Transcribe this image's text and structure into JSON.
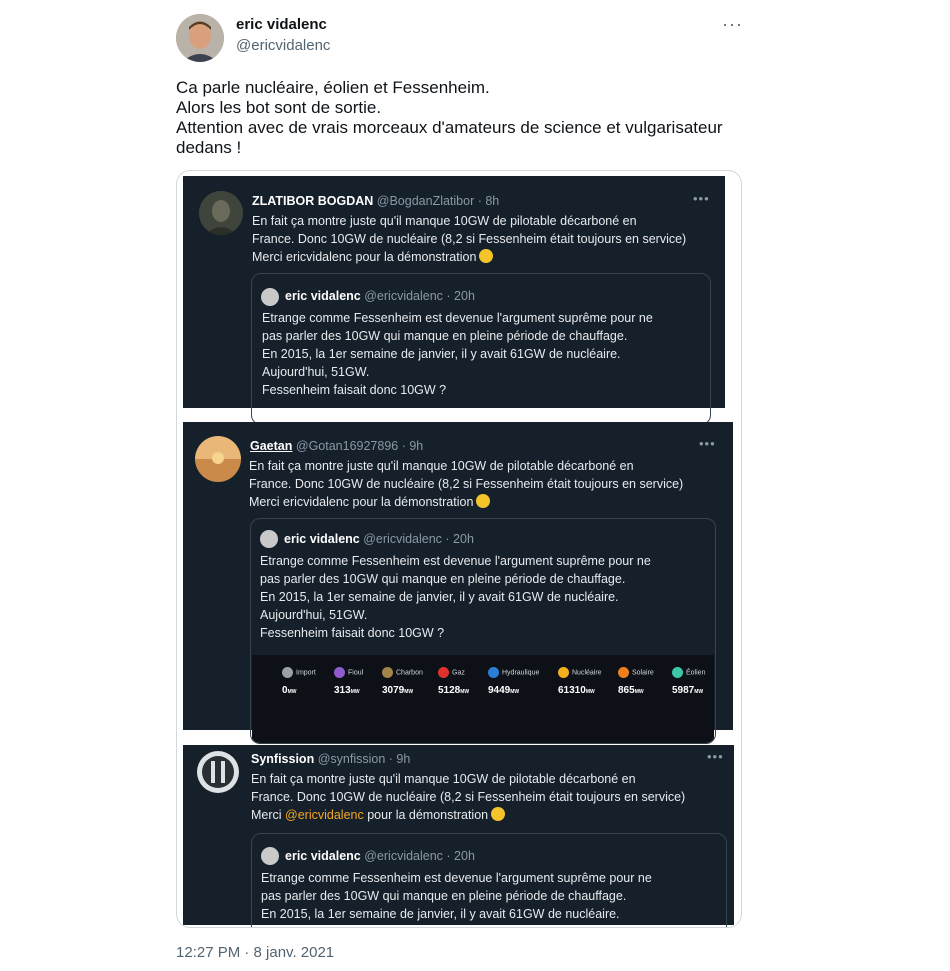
{
  "tweet": {
    "author_name": "eric vidalenc",
    "author_handle": "@ericvidalenc",
    "more_label": "···",
    "text_lines": [
      "Ca parle nucléaire, éolien et Fessenheim.",
      "Alors les bot sont de sortie.",
      "Attention avec de vrais morceaux d'amateurs de science et vulgarisateur",
      "dedans !"
    ],
    "timestamp": "12:27 PM · 8 janv. 2021"
  },
  "screenshots": [
    {
      "name": "ZLATIBOR BOGDAN",
      "handle": "@BogdanZlatibor · 8h",
      "lines": [
        "En fait ça montre juste qu'il manque 10GW de pilotable décarboné en",
        "France. Donc 10GW de nucléaire (8,2 si Fessenheim était toujours en service)"
      ],
      "last_prefix": "Merci  ericvidalenc pour la démonstration",
      "quote": {
        "name": "eric vidalenc",
        "handle": "@ericvidalenc · 20h",
        "lines": [
          "Etrange comme Fessenheim est devenue l'argument suprême pour ne",
          "pas parler des 10GW qui manque en pleine période de chauffage.",
          "En 2015, la 1er semaine de janvier, il y avait 61GW de nucléaire.",
          "Aujourd'hui, 51GW.",
          "Fessenheim faisait donc 10GW ?"
        ]
      }
    },
    {
      "name": "Gaetan",
      "handle": "@Gotan16927896 · 9h",
      "lines": [
        "En fait ça montre juste qu'il manque 10GW de pilotable décarboné en",
        "France. Donc 10GW de nucléaire (8,2 si Fessenheim était toujours en service)"
      ],
      "last_prefix": "Merci  ericvidalenc pour la démonstration",
      "quote": {
        "name": "eric vidalenc",
        "handle": "@ericvidalenc · 20h",
        "lines": [
          "Etrange comme Fessenheim est devenue l'argument suprême pour ne",
          "pas parler des 10GW qui manque en pleine période de chauffage.",
          "En 2015, la 1er semaine de janvier, il y avait 61GW de nucléaire.",
          "Aujourd'hui, 51GW.",
          "Fessenheim faisait donc 10GW ?"
        ]
      },
      "energy": [
        {
          "label": "Import",
          "value": "0",
          "unit": "MW",
          "color": "#9aa0a6"
        },
        {
          "label": "Fioul",
          "value": "313",
          "unit": "MW",
          "color": "#8e5ccf"
        },
        {
          "label": "Charbon",
          "value": "3079",
          "unit": "MW",
          "color": "#a3844a"
        },
        {
          "label": "Gaz",
          "value": "5128",
          "unit": "MW",
          "color": "#e0322c"
        },
        {
          "label": "Hydraulique",
          "value": "9449",
          "unit": "MW",
          "color": "#2a7fd6"
        },
        {
          "label": "Nucléaire",
          "value": "61310",
          "unit": "MW",
          "color": "#f2b01e"
        },
        {
          "label": "Solaire",
          "value": "865",
          "unit": "MW",
          "color": "#f07f1c"
        },
        {
          "label": "Éolien",
          "value": "5987",
          "unit": "MW",
          "color": "#3cc8a8"
        }
      ]
    },
    {
      "name": "Synfission",
      "handle": "@synfission · 9h",
      "lines": [
        "En fait ça montre juste qu'il manque 10GW de pilotable décarboné en",
        "France. Donc 10GW de nucléaire (8,2 si Fessenheim était toujours en service)"
      ],
      "last_before": "Merci ",
      "last_mention": "@ericvidalenc",
      "last_after": " pour la démonstration",
      "quote": {
        "name": "eric vidalenc",
        "handle": "@ericvidalenc · 20h",
        "lines": [
          "Etrange comme Fessenheim est devenue l'argument suprême pour ne",
          "pas parler des 10GW qui manque en pleine période de chauffage.",
          "En 2015, la 1er semaine de janvier, il y avait 61GW de nucléaire."
        ]
      }
    }
  ]
}
